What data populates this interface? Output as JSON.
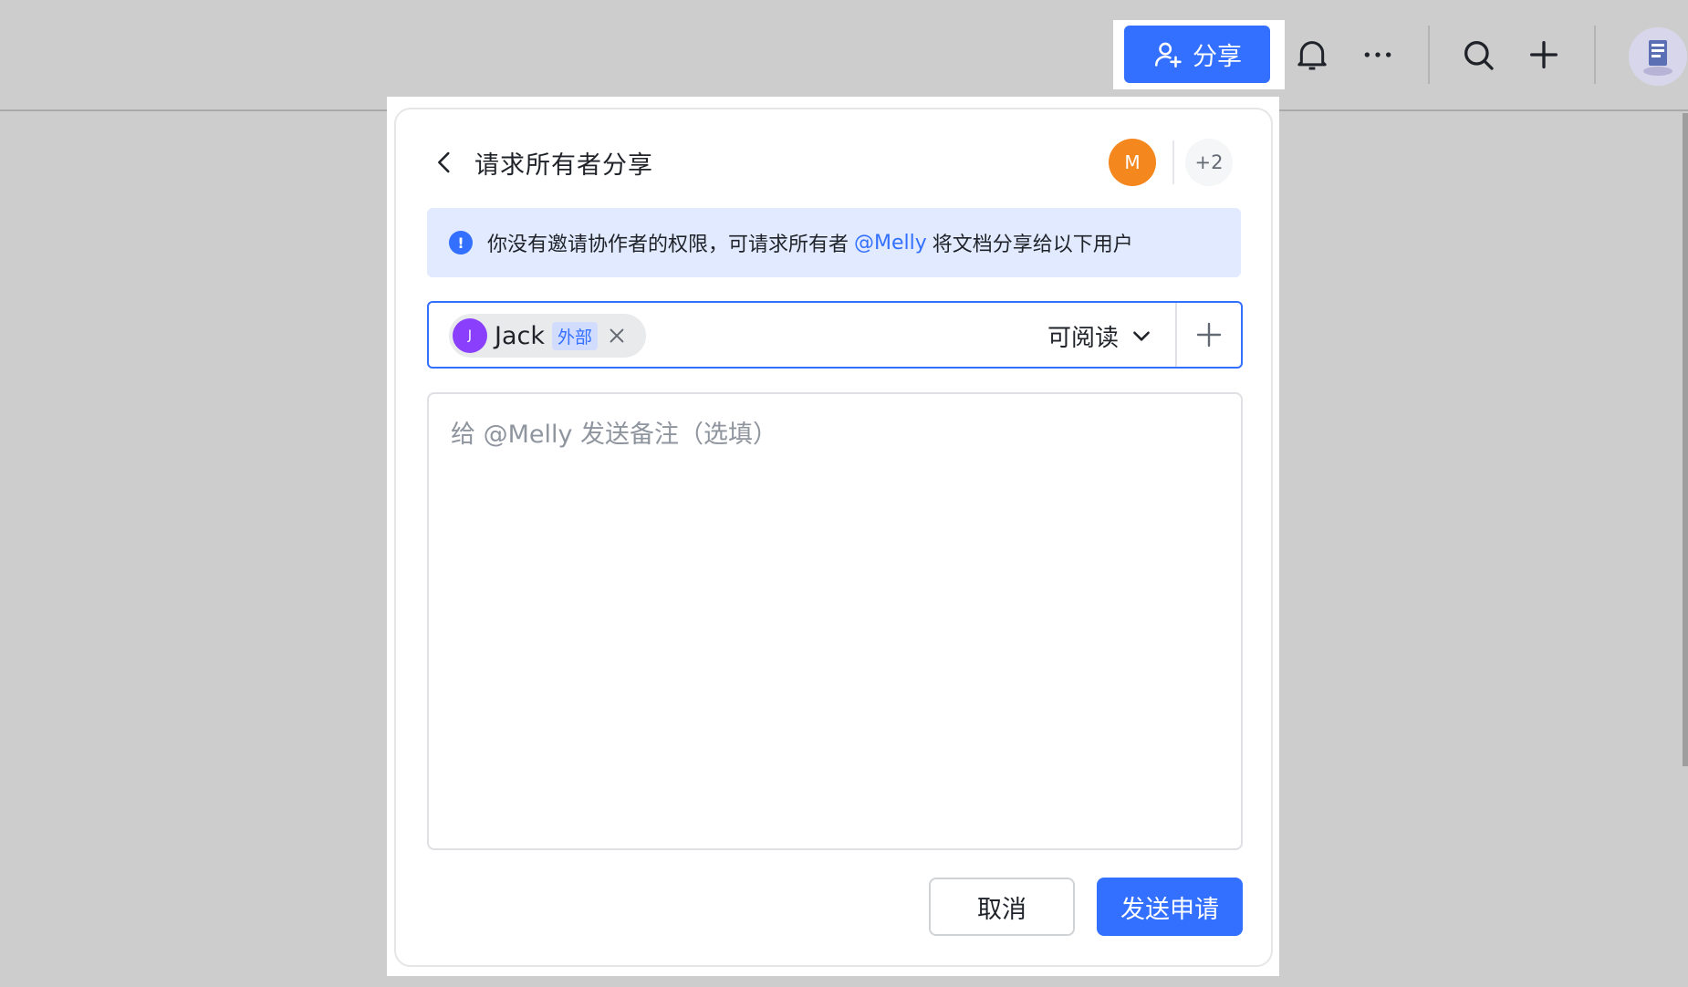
{
  "topbar": {
    "share_label": "分享",
    "icons": [
      "add-user-icon",
      "bell-icon",
      "more-icon",
      "search-icon",
      "plus-icon"
    ]
  },
  "modal": {
    "title": "请求所有者分享",
    "owner_initial": "M",
    "extra_count": "+2",
    "notice": {
      "prefix": "你没有邀请协作者的权限，可请求所有者",
      "mention": "@Melly",
      "suffix": "将文档分享给以下用户"
    },
    "invitee": {
      "initial": "J",
      "name": "Jack",
      "tag": "外部"
    },
    "permission": "可阅读",
    "note_placeholder": "给 @Melly 发送备注（选填）",
    "cancel_label": "取消",
    "send_label": "发送申请"
  },
  "colors": {
    "accent": "#3370ff",
    "owner_avatar": "#f5871f",
    "invitee_avatar": "#8a3ffc",
    "notice_bg": "#e1eaff"
  }
}
